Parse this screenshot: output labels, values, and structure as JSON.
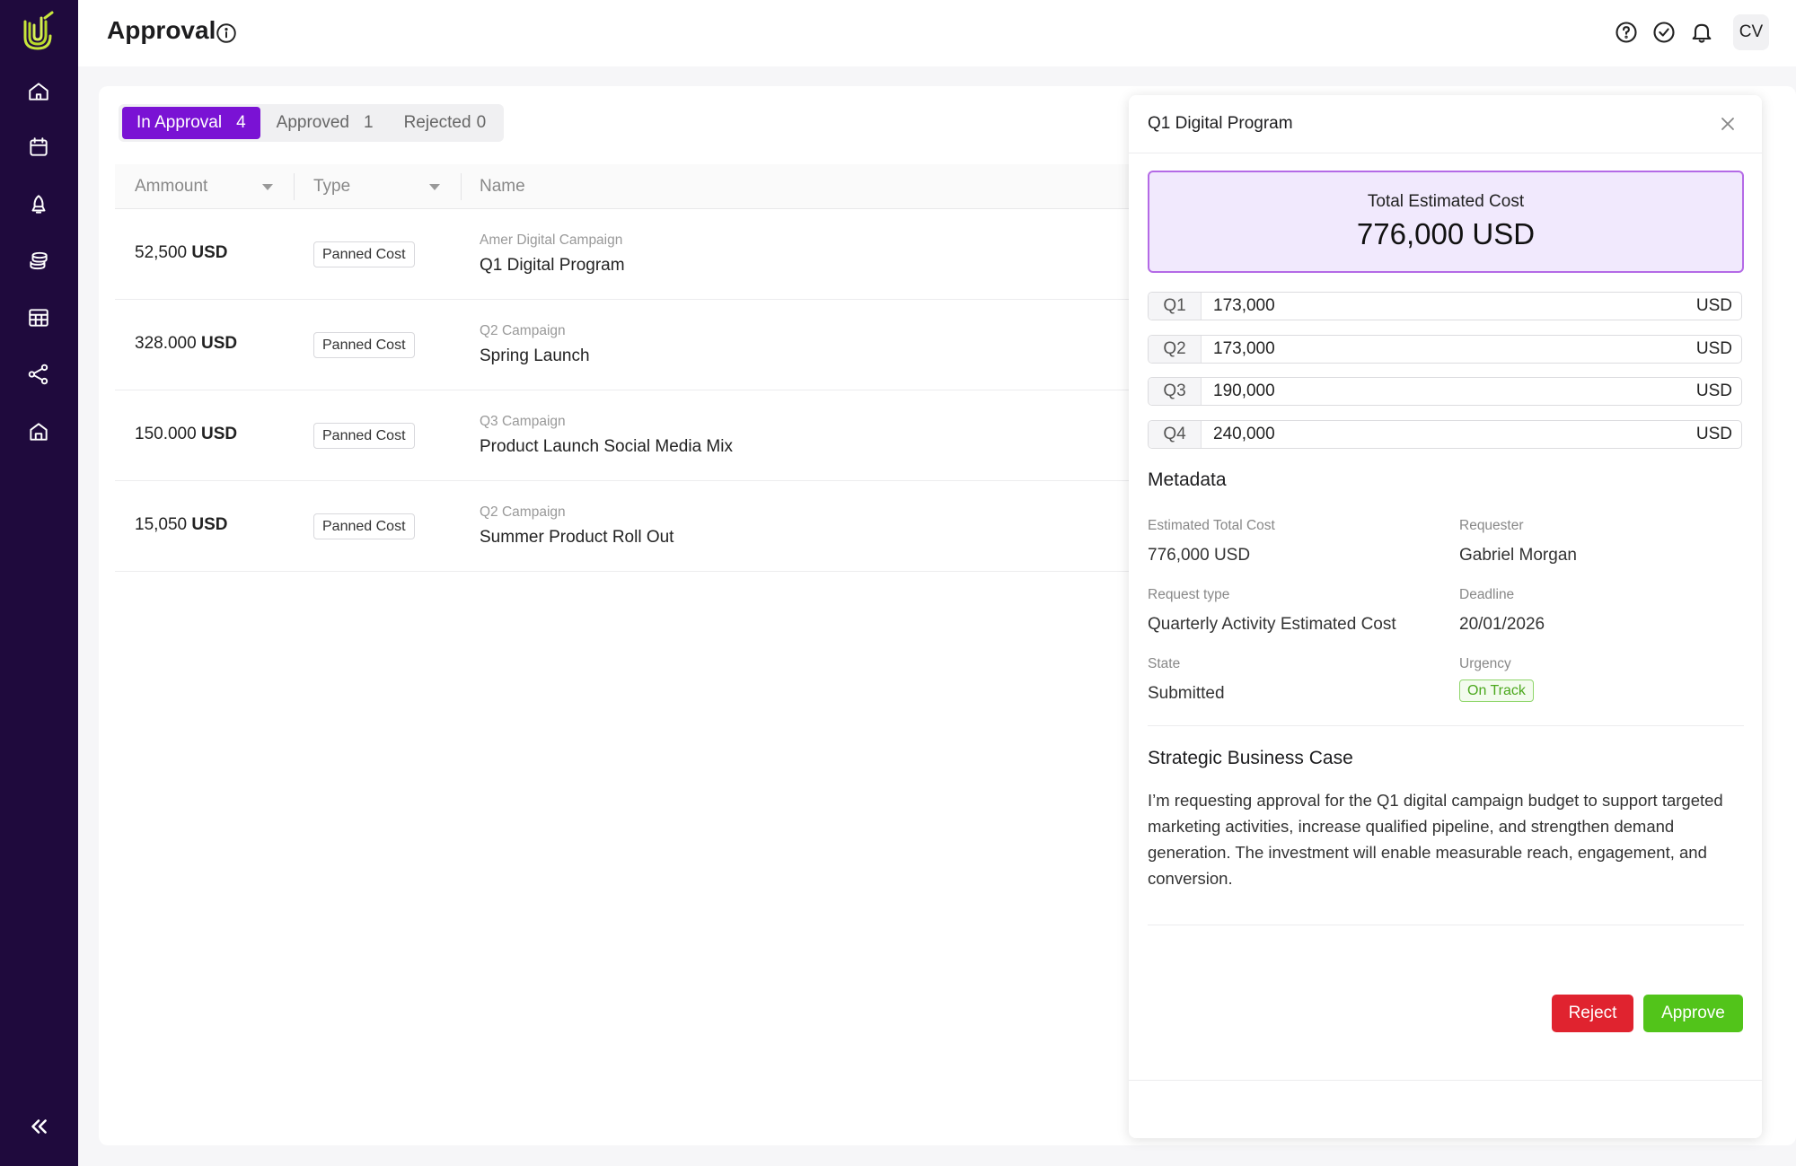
{
  "app": {
    "title": "Approval"
  },
  "header": {
    "avatar_initials": "CV",
    "icons": [
      "help-circle-icon",
      "check-circle-icon",
      "bell-icon"
    ]
  },
  "sidebar": {
    "items": [
      "home-icon",
      "calendar-icon",
      "rocket-icon",
      "coins-icon",
      "table-icon",
      "share-nodes-icon",
      "house-icon"
    ],
    "collapse": "double-chevron-left-icon"
  },
  "tabs": [
    {
      "label": "In Approval",
      "count": "4",
      "active": true
    },
    {
      "label": "Approved",
      "count": "1",
      "active": false
    },
    {
      "label": "Rejected",
      "count": "0",
      "active": false
    }
  ],
  "table": {
    "columns": [
      "Ammount",
      "Type",
      "Name"
    ],
    "rows": [
      {
        "amount": "52,500",
        "currency": "USD",
        "type": "Panned Cost",
        "campaign": "Amer Digital Campaign",
        "name": "Q1 Digital Program"
      },
      {
        "amount": "328.000",
        "currency": "USD",
        "type": "Panned Cost",
        "campaign": "Q2 Campaign",
        "name": "Spring Launch"
      },
      {
        "amount": "150.000",
        "currency": "USD",
        "type": "Panned Cost",
        "campaign": "Q3 Campaign",
        "name": "Product Launch Social Media Mix"
      },
      {
        "amount": "15,050",
        "currency": "USD",
        "type": "Panned Cost",
        "campaign": "Q2 Campaign",
        "name": "Summer Product Roll Out"
      }
    ]
  },
  "panel": {
    "title": "Q1 Digital Program",
    "total_label": "Total Estimated Cost",
    "total_value": "776,000 USD",
    "quarters": [
      {
        "label": "Q1",
        "value": "173,000",
        "unit": "USD"
      },
      {
        "label": "Q2",
        "value": "173,000",
        "unit": "USD"
      },
      {
        "label": "Q3",
        "value": "190,000",
        "unit": "USD"
      },
      {
        "label": "Q4",
        "value": "240,000",
        "unit": "USD"
      }
    ],
    "metadata_title": "Metadata",
    "metadata": {
      "estimated_total_cost_label": "Estimated Total Cost",
      "estimated_total_cost": "776,000 USD",
      "requester_label": "Requester",
      "requester": "Gabriel Morgan",
      "request_type_label": "Request type",
      "request_type": "Quarterly Activity Estimated Cost",
      "deadline_label": "Deadline",
      "deadline": "20/01/2026",
      "state_label": "State",
      "state": "Submitted",
      "urgency_label": "Urgency",
      "urgency": "On Track"
    },
    "business_case_title": "Strategic Business Case",
    "business_case_text": "I’m requesting approval for the Q1 digital campaign budget to support targeted marketing activities, increase qualified pipeline, and strengthen demand generation. The investment will enable measurable reach, engagement, and conversion.",
    "reject_label": "Reject",
    "approve_label": "Approve"
  },
  "colors": {
    "sidebar": "#1f0a3d",
    "accent": "#7a12d4",
    "reject": "#e0232f",
    "approve": "#52c41a",
    "urgency": "#4ba81d"
  }
}
